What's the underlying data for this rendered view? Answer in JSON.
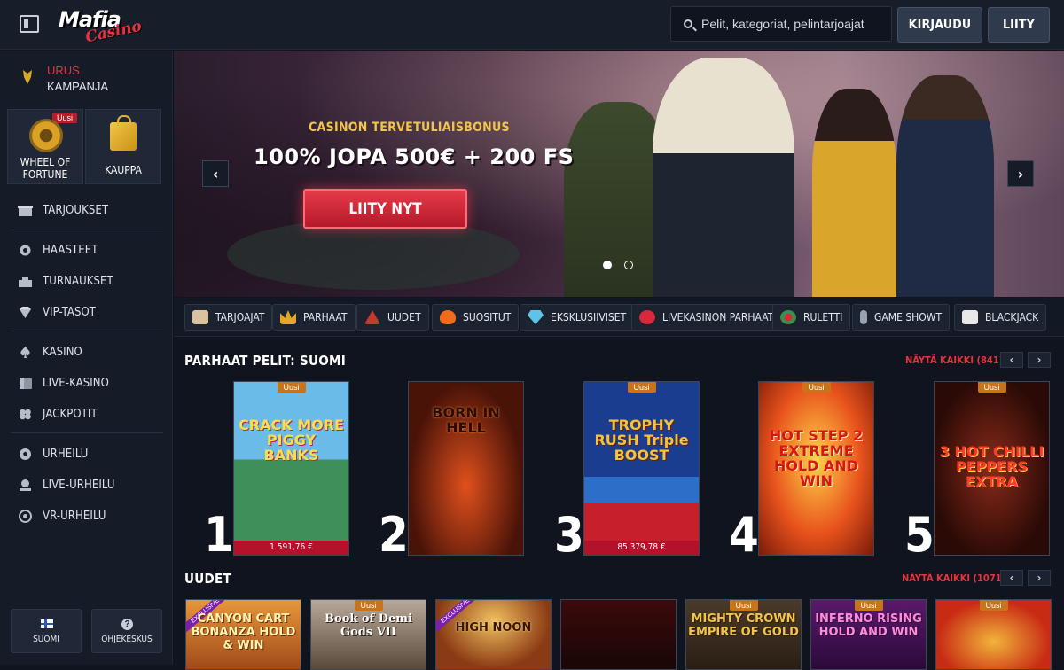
{
  "header": {
    "logo_main": "Mafia",
    "logo_sub": "Casino",
    "search_placeholder": "Pelit, kategoriat, pelintarjoajat",
    "login_label": "KIRJAUDU",
    "join_label": "LIITY"
  },
  "sidebar": {
    "promo_line1": "URUS",
    "promo_line2": "KAMPANJA",
    "tiles": [
      {
        "label": "WHEEL OF FORTUNE",
        "badge": "Uusi"
      },
      {
        "label": "KAUPPA"
      }
    ],
    "items": [
      {
        "label": "TARJOUKSET",
        "icon": "offers-icon"
      },
      {
        "label": "HAASTEET",
        "icon": "challenges-icon"
      },
      {
        "label": "TURNAUKSET",
        "icon": "tournaments-icon"
      },
      {
        "label": "VIP-TASOT",
        "icon": "vip-icon"
      },
      {
        "label": "KASINO",
        "icon": "spade-icon"
      },
      {
        "label": "LIVE-KASINO",
        "icon": "live-casino-icon"
      },
      {
        "label": "JACKPOTIT",
        "icon": "clover-icon"
      },
      {
        "label": "URHEILU",
        "icon": "football-icon"
      },
      {
        "label": "LIVE-URHEILU",
        "icon": "live-sports-icon"
      },
      {
        "label": "VR-URHEILU",
        "icon": "vr-sports-icon"
      }
    ],
    "footer": {
      "lang_label": "SUOMI",
      "help_label": "OHJEKESKUS",
      "help_glyph": "?"
    }
  },
  "hero": {
    "subtitle": "CASINON TERVETULIAISBONUS",
    "title": "100% JOPA 500€ + 200 FS",
    "cta": "LIITY NYT",
    "prev_glyph": "‹",
    "next_glyph": "›",
    "slide_count": 2,
    "active_slide": 1
  },
  "categories": [
    {
      "label": "TARJOAJAT",
      "icon": "providers-icon",
      "color": "#d9c2a0"
    },
    {
      "label": "PARHAAT",
      "icon": "crown-icon",
      "color": "#e3a826"
    },
    {
      "label": "UUDET",
      "icon": "new-icon",
      "color": "#c43a2e"
    },
    {
      "label": "SUOSITUT",
      "icon": "fire-icon",
      "color": "#f26b1d"
    },
    {
      "label": "EKSKLUSIIVISET",
      "icon": "diamond-icon",
      "color": "#5bc4e8"
    },
    {
      "label": "LIVEKASINON PARHAAT",
      "icon": "chip-icon",
      "color": "#d8283a"
    },
    {
      "label": "RULETTI",
      "icon": "roulette-icon",
      "color": "#3a8f4a"
    },
    {
      "label": "GAME SHOWT",
      "icon": "microphone-icon",
      "color": "#9aa3b2"
    },
    {
      "label": "BLACKJACK",
      "icon": "cards-icon",
      "color": "#e8e8e8"
    }
  ],
  "top_games": {
    "title": "PARHAAT PELIT: SUOMI",
    "see_all": "NÄYTÄ KAIKKI (841)",
    "prev": "‹",
    "next": "›",
    "items": [
      {
        "rank": "1",
        "badge": "Uusi",
        "title": "CRACK MORE PIGGY BANKS",
        "jackpot": "1 591,76 €"
      },
      {
        "rank": "2",
        "badge": "",
        "title": "BORN IN HELL",
        "jackpot": ""
      },
      {
        "rank": "3",
        "badge": "Uusi",
        "title": "TROPHY RUSH Triple BOOST",
        "jackpot": "85 379,78 €"
      },
      {
        "rank": "4",
        "badge": "Uusi",
        "title": "HOT STEP 2 EXTREME HOLD AND WIN",
        "jackpot": ""
      },
      {
        "rank": "5",
        "badge": "Uusi",
        "title": "3 HOT CHILLI PEPPERS EXTRA",
        "jackpot": ""
      }
    ]
  },
  "new_games": {
    "title": "UUDET",
    "see_all": "NÄYTÄ KAIKKI (1071)",
    "prev": "‹",
    "next": "›",
    "items": [
      {
        "badge": "",
        "exclusive": "EXCLUSIVE",
        "title": "CANYON CART BONANZA HOLD & WIN"
      },
      {
        "badge": "Uusi",
        "exclusive": "",
        "title": "Book of Demi Gods VII"
      },
      {
        "badge": "",
        "exclusive": "EXCLUSIVE",
        "title": "HIGH NOON"
      },
      {
        "badge": "",
        "exclusive": "",
        "title": ""
      },
      {
        "badge": "Uusi",
        "exclusive": "",
        "title": "MIGHTY CROWN EMPIRE OF GOLD"
      },
      {
        "badge": "Uusi",
        "exclusive": "",
        "title": "INFERNO RISING HOLD AND WIN"
      },
      {
        "badge": "Uusi",
        "exclusive": "",
        "title": ""
      }
    ]
  }
}
